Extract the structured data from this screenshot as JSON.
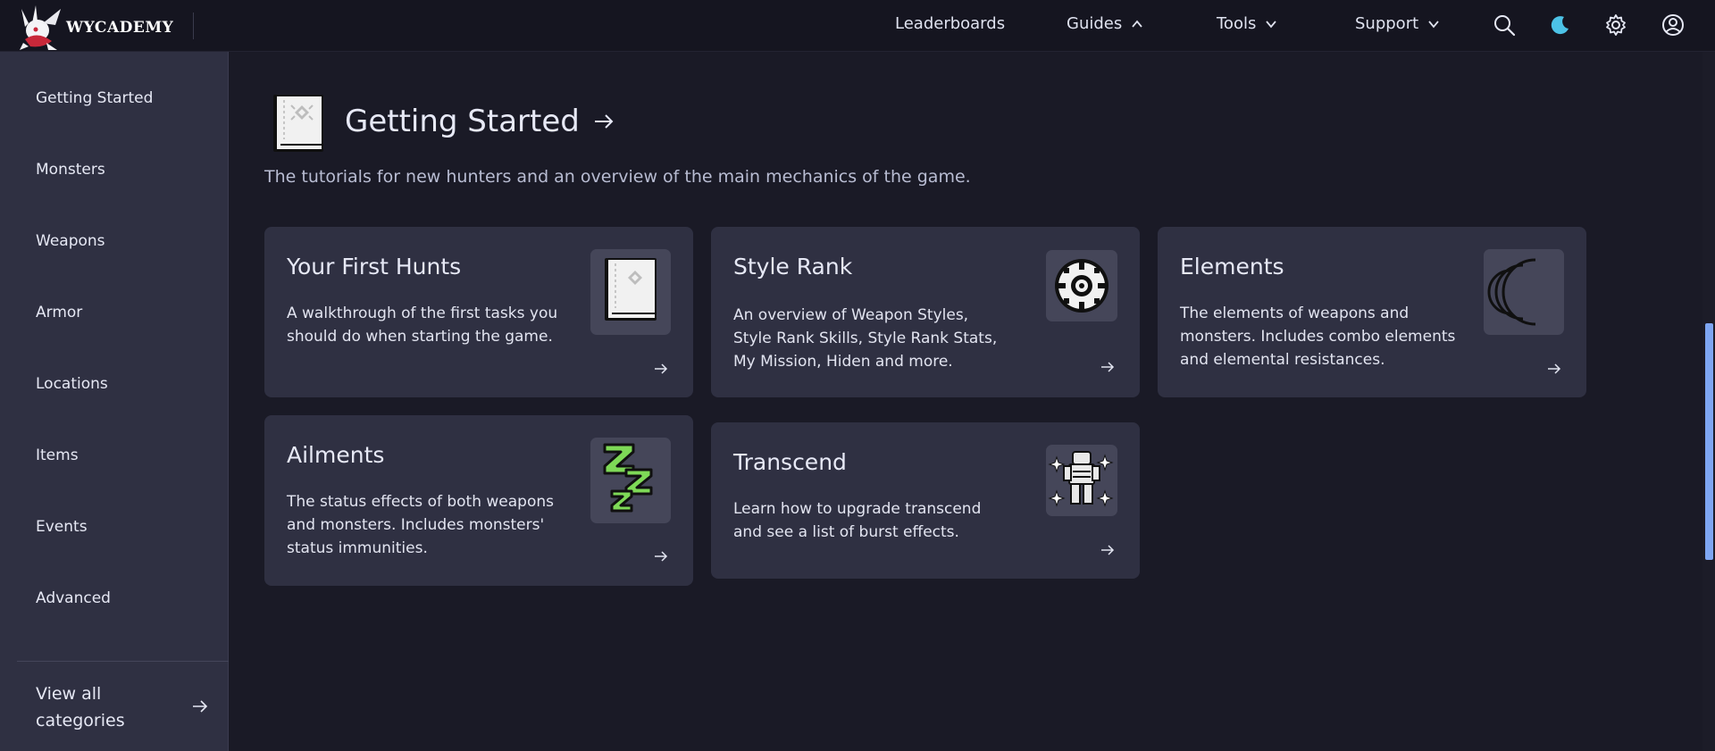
{
  "header": {
    "brand": "WYCADEMY",
    "nav": [
      {
        "label": "Leaderboards"
      },
      {
        "label": "Guides"
      },
      {
        "label": "Tools"
      },
      {
        "label": "Support"
      }
    ]
  },
  "sidebar": {
    "items": [
      {
        "label": "Getting Started"
      },
      {
        "label": "Monsters"
      },
      {
        "label": "Weapons"
      },
      {
        "label": "Armor"
      },
      {
        "label": "Locations"
      },
      {
        "label": "Items"
      },
      {
        "label": "Events"
      },
      {
        "label": "Advanced"
      }
    ],
    "view_all": "View all categories"
  },
  "section": {
    "title": "Getting Started",
    "description": "The tutorials for new hunters and an overview of the main mechanics of the game."
  },
  "cards": [
    {
      "title": "Your First Hunts",
      "description": "A walkthrough of the first tasks you should do when starting the game.",
      "icon": "book-icon"
    },
    {
      "title": "Style Rank",
      "description": "An overview of Weapon Styles, Style Rank Skills, Style Rank Stats, My Mission, Hiden and more.",
      "icon": "style-rank-emblem-icon"
    },
    {
      "title": "Elements",
      "description": "The elements of weapons and monsters. Includes combo elements and elemental resistances.",
      "icon": "crescent-moons-icon"
    },
    {
      "title": "Ailments",
      "description": "The status effects of both weapons and monsters. Includes monsters' status immunities.",
      "icon": "sleep-zzz-icon"
    },
    {
      "title": "Transcend",
      "description": "Learn how to upgrade transcend and see a list of burst effects.",
      "icon": "sparkling-hunter-icon"
    }
  ],
  "colors": {
    "page_bg": "#1a1a26",
    "topbar_bg": "#151520",
    "panel_bg": "#2f3042",
    "thumb_bg": "#454659",
    "accent_moon": "#4cc2e6",
    "scrollbar": "#7ea6f2",
    "zzz_green": "#7ed957"
  }
}
